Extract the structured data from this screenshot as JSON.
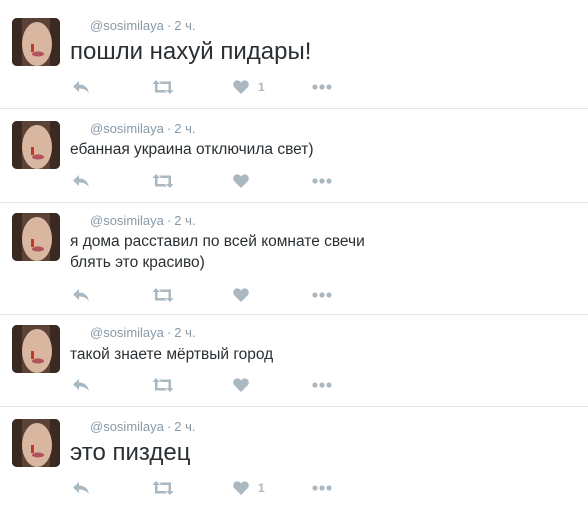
{
  "colors": {
    "icon": "#aab8c2",
    "meta": "#8899a6",
    "text": "#292f33",
    "divider": "#e1e8ed"
  },
  "tweets": [
    {
      "username": "@sosimilaya",
      "dot": "·",
      "time": "2 ч.",
      "lines": [
        "пошли нахуй пидары!"
      ],
      "size": "big",
      "like_count": "1"
    },
    {
      "username": "@sosimilaya",
      "dot": "·",
      "time": "2 ч.",
      "lines": [
        "ебанная украина отключила свет)"
      ],
      "size": "small",
      "like_count": ""
    },
    {
      "username": "@sosimilaya",
      "dot": "·",
      "time": "2 ч.",
      "lines": [
        "я дома расставил по всей комнате свечи",
        "блять это красиво)"
      ],
      "size": "small",
      "like_count": ""
    },
    {
      "username": "@sosimilaya",
      "dot": "·",
      "time": "2 ч.",
      "lines": [
        "такой знаете мёртвый город"
      ],
      "size": "small",
      "like_count": ""
    },
    {
      "username": "@sosimilaya",
      "dot": "·",
      "time": "2 ч.",
      "lines": [
        "это пиздец"
      ],
      "size": "big",
      "like_count": "1"
    }
  ],
  "icons": {
    "reply": "reply-icon",
    "retweet": "retweet-icon",
    "like": "heart-icon",
    "more": "more-icon",
    "avatar": "avatar"
  }
}
